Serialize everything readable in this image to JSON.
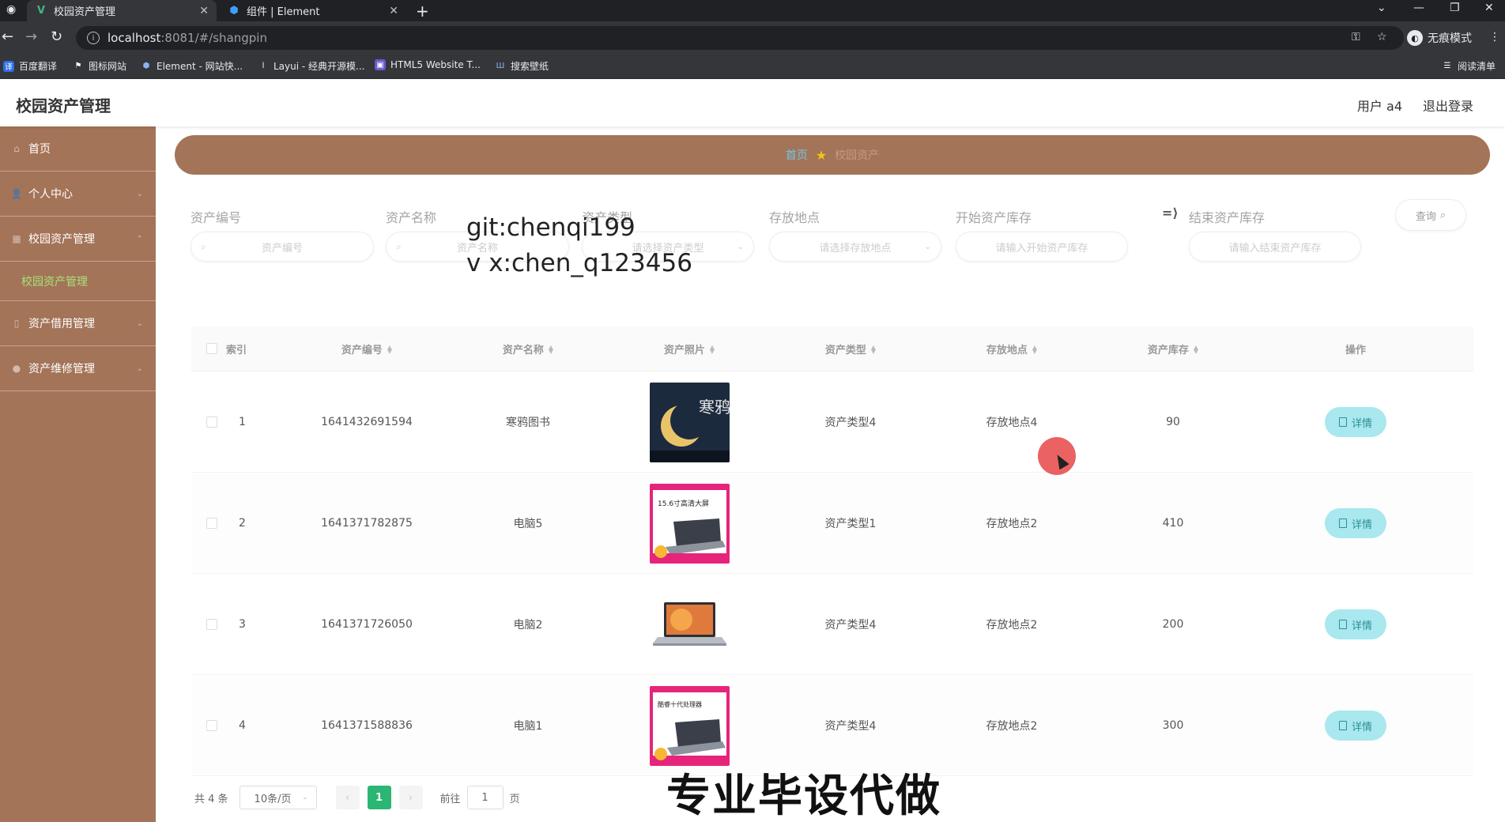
{
  "browser": {
    "tabs": [
      {
        "title": "校园资产管理",
        "icon": "vue-logo-icon"
      },
      {
        "title": "组件 | Element",
        "icon": "element-logo-icon"
      }
    ],
    "url_host": "localhost",
    "url_path": ":8081/#/shangpin",
    "incognito_label": "无痕模式",
    "reading_list_label": "阅读清单",
    "bookmarks": [
      {
        "label": "百度翻译",
        "color": "#2b6ce8"
      },
      {
        "label": "图标网站",
        "color": "#222222"
      },
      {
        "label": "Element - 网站快...",
        "color": "#409eff"
      },
      {
        "label": "Layui - 经典开源模...",
        "color": "#222222"
      },
      {
        "label": "HTML5 Website T...",
        "color": "#6a5acd"
      },
      {
        "label": "搜索壁纸",
        "color": "#3b82f6"
      }
    ]
  },
  "header": {
    "title": "校园资产管理",
    "user": "用户 a4",
    "logout": "退出登录"
  },
  "sidebar": {
    "items": [
      {
        "label": "首页"
      },
      {
        "label": "个人中心"
      },
      {
        "label": "校园资产管理"
      },
      {
        "label": "校园资产管理",
        "sub": true
      },
      {
        "label": "资产借用管理"
      },
      {
        "label": "资产维修管理"
      }
    ]
  },
  "breadcrumb": {
    "home": "首页",
    "current": "校园资产"
  },
  "filters": {
    "asset_code": {
      "label": "资产编号",
      "placeholder": "资产编号"
    },
    "asset_name": {
      "label": "资产名称",
      "placeholder": "资产名称"
    },
    "asset_type": {
      "label": "资产类型",
      "placeholder": "请选择资产类型"
    },
    "location": {
      "label": "存放地点",
      "placeholder": "请选择存放地点"
    },
    "stock_start": {
      "label": "开始资产库存",
      "placeholder": "请输入开始资产库存"
    },
    "stock_end": {
      "label": "结束资产库存",
      "placeholder": "请输入结束资产库存"
    },
    "query_label": "查询"
  },
  "watermark": {
    "line1": "git:chenqi199",
    "line2": "v x:chen_q123456",
    "bottom": "专业毕设代做"
  },
  "table": {
    "columns": {
      "index": "索引",
      "code": "资产编号",
      "name": "资产名称",
      "photo": "资产照片",
      "type": "资产类型",
      "location": "存放地点",
      "stock": "资产库存",
      "actions": "操作"
    },
    "rows": [
      {
        "index": "1",
        "code": "1641432691594",
        "name": "寒鸦图书",
        "photo": "book-cover",
        "type": "资产类型4",
        "location": "存放地点4",
        "stock": "90",
        "action": "详情"
      },
      {
        "index": "2",
        "code": "1641371782875",
        "name": "电脑5",
        "photo": "laptop-ad",
        "type": "资产类型1",
        "location": "存放地点2",
        "stock": "410",
        "action": "详情"
      },
      {
        "index": "3",
        "code": "1641371726050",
        "name": "电脑2",
        "photo": "laptop",
        "type": "资产类型4",
        "location": "存放地点2",
        "stock": "200",
        "action": "详情"
      },
      {
        "index": "4",
        "code": "1641371588836",
        "name": "电脑1",
        "photo": "laptop-ad",
        "type": "资产类型4",
        "location": "存放地点2",
        "stock": "300",
        "action": "详情"
      }
    ]
  },
  "pagination": {
    "total": "共 4 条",
    "page_size": "10条/页",
    "current_page": "1",
    "goto_prefix": "前往",
    "goto_value": "1",
    "goto_suffix": "页"
  },
  "colors": {
    "sidebar": "#a47458",
    "active_submenu": "#a5e27a",
    "page_active": "#2bb673",
    "detail_button": "#a8e8ee"
  },
  "book_cover_text": "寒鸦",
  "laptop_ad_headline": "15.6寸高清大屏",
  "laptop_ad_headline_2": "酷睿十代处理器"
}
